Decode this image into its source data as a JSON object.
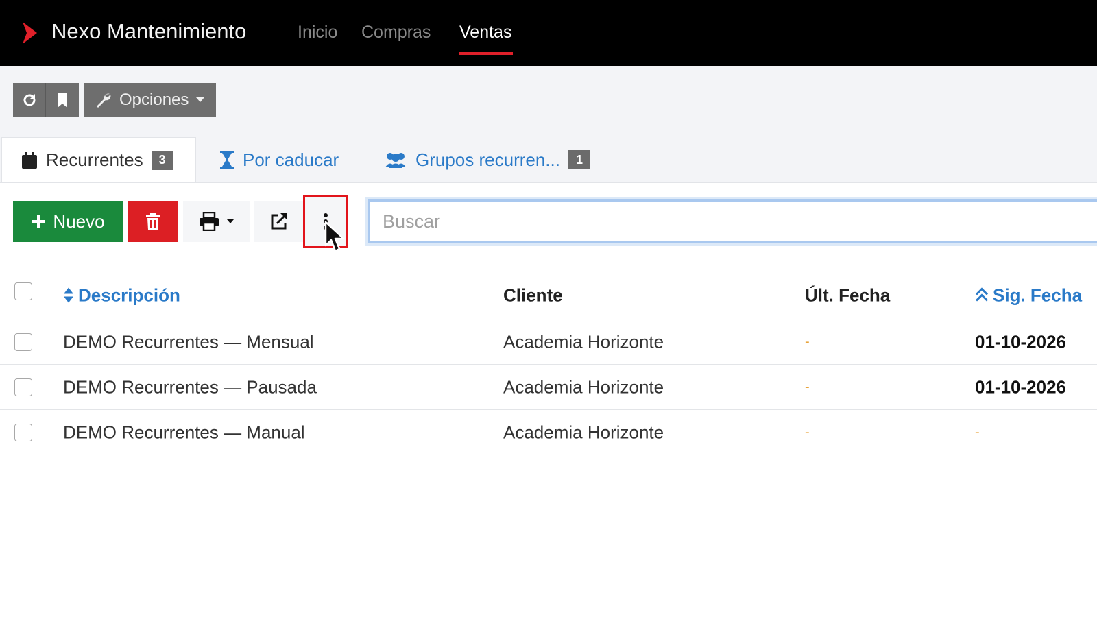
{
  "app": {
    "name": "Nexo Mantenimiento",
    "nav": [
      {
        "label": "Inicio",
        "active": false
      },
      {
        "label": "Compras",
        "active": false
      },
      {
        "label": "Ventas",
        "active": true
      }
    ]
  },
  "toolbar": {
    "refresh_icon": "refresh-icon",
    "bookmark_icon": "bookmark-icon",
    "options_label": "Opciones"
  },
  "tabs": [
    {
      "label": "Recurrentes",
      "badge": "3",
      "icon": "calendar-icon",
      "active": true
    },
    {
      "label": "Por caducar",
      "badge": null,
      "icon": "hourglass-icon",
      "active": false
    },
    {
      "label": "Grupos recurren...",
      "badge": "1",
      "icon": "users-icon",
      "active": false
    }
  ],
  "actions": {
    "new_label": "Nuevo",
    "search_placeholder": "Buscar",
    "search_value": ""
  },
  "table": {
    "columns": [
      "Descripción",
      "Cliente",
      "Últ. Fecha",
      "Sig. Fecha"
    ],
    "rows": [
      {
        "description": "DEMO Recurrentes — Mensual",
        "client": "Academia Horizonte",
        "last_date": "-",
        "next_date": "01-10-2026"
      },
      {
        "description": "DEMO Recurrentes — Pausada",
        "client": "Academia Horizonte",
        "last_date": "-",
        "next_date": "01-10-2026"
      },
      {
        "description": "DEMO Recurrentes — Manual",
        "client": "Academia Horizonte",
        "last_date": "-",
        "next_date": "-"
      }
    ]
  },
  "colors": {
    "accent_red": "#e0202a",
    "link_blue": "#2a7ac8",
    "success_green": "#1a8a3c",
    "danger_red": "#dc1f24",
    "dash_orange": "#e8a33a"
  }
}
